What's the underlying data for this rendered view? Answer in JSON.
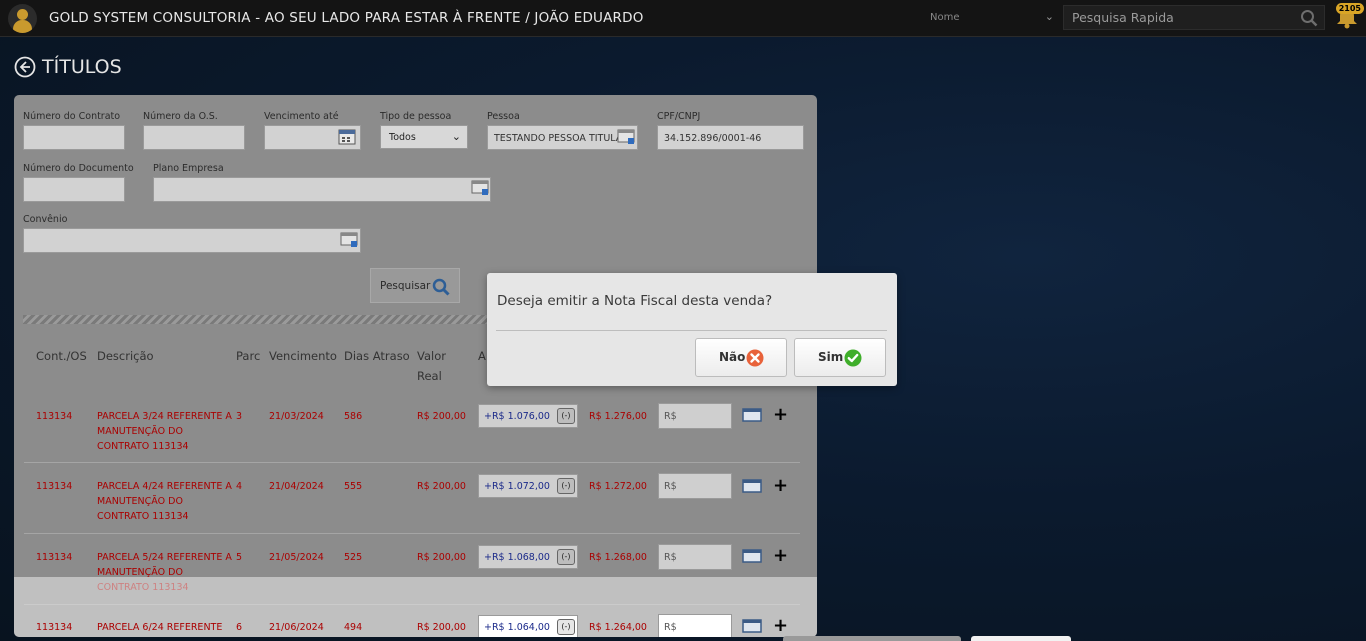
{
  "header": {
    "app_title": "GOLD SYSTEM CONSULTORIA - AO SEU LADO PARA ESTAR À FRENTE / JOÃO EDUARDO",
    "search_type": "Nome",
    "search_placeholder": "Pesquisa Rapida",
    "notification_count": "2105"
  },
  "page": {
    "title": "TÍTULOS"
  },
  "filters": {
    "numero_contrato_label": "Número do Contrato",
    "numero_os_label": "Número da O.S.",
    "vencimento_label": "Vencimento até",
    "tipo_pessoa_label": "Tipo de pessoa",
    "tipo_pessoa_value": "Todos",
    "pessoa_label": "Pessoa",
    "pessoa_value": "TESTANDO PESSOA TITULAR",
    "cpf_label": "CPF/CNPJ",
    "cpf_value": "34.152.896/0001-46",
    "numero_documento_label": "Número do Documento",
    "plano_empresa_label": "Plano Empresa",
    "convenio_label": "Convênio",
    "search_button": "Pesquisar"
  },
  "table": {
    "headers": {
      "cont_os": "Cont./OS",
      "descricao": "Descrição",
      "parc": "Parc",
      "vencimento": "Vencimento",
      "dias_atraso": "Dias Atraso",
      "valor_real": "Valor Real",
      "col_a": "A"
    },
    "rows": [
      {
        "cont": "113134",
        "descricao": "PARCELA 3/24 REFERENTE A MANUTENÇÃO DO CONTRATO 113134",
        "parc": "3",
        "vencimento": "21/03/2024",
        "dias": "586",
        "valor": "R$ 200,00",
        "acrescimo": "+R$ 1.076,00",
        "minus": "(-)",
        "total": "R$ 1.276,00",
        "pagar": "R$"
      },
      {
        "cont": "113134",
        "descricao": "PARCELA 4/24 REFERENTE A MANUTENÇÃO DO CONTRATO 113134",
        "parc": "4",
        "vencimento": "21/04/2024",
        "dias": "555",
        "valor": "R$ 200,00",
        "acrescimo": "+R$ 1.072,00",
        "minus": "(-)",
        "total": "R$ 1.272,00",
        "pagar": "R$"
      },
      {
        "cont": "113134",
        "descricao": "PARCELA 5/24 REFERENTE A MANUTENÇÃO DO CONTRATO 113134",
        "parc": "5",
        "vencimento": "21/05/2024",
        "dias": "525",
        "valor": "R$ 200,00",
        "acrescimo": "+R$ 1.068,00",
        "minus": "(-)",
        "total": "R$ 1.268,00",
        "pagar": "R$"
      },
      {
        "cont": "113134",
        "descricao": "PARCELA 6/24 REFERENTE",
        "parc": "6",
        "vencimento": "21/06/2024",
        "dias": "494",
        "valor": "R$ 200,00",
        "acrescimo": "+R$ 1.064,00",
        "minus": "(-)",
        "total": "R$ 1.264,00",
        "pagar": "R$"
      }
    ]
  },
  "dialog": {
    "message": "Deseja emitir a Nota Fiscal desta venda?",
    "no_label": "Não",
    "yes_label": "Sim"
  },
  "colors": {
    "accent_gold": "#c99a2e",
    "danger": "#e8623a",
    "success": "#3fae2a",
    "row_text": "#aa0000"
  }
}
